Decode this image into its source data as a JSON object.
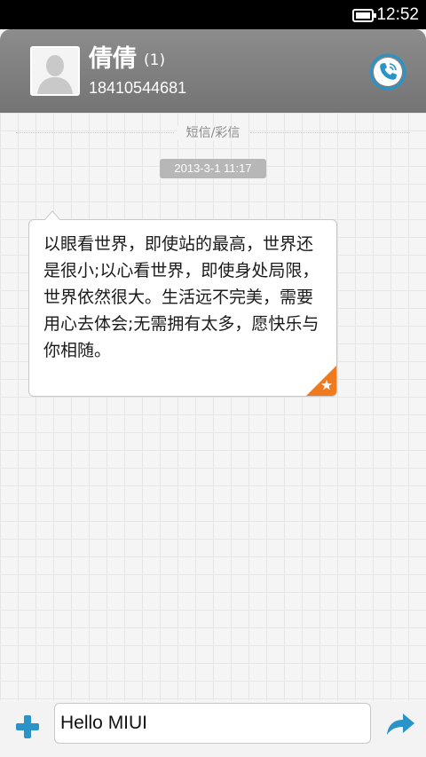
{
  "status_bar": {
    "time": "12:52",
    "icons": [
      "battery-icon"
    ]
  },
  "header": {
    "contact_name": "倩倩",
    "message_count": "(1)",
    "phone_number": "18410544681",
    "icons": [
      "avatar-placeholder-icon",
      "phone-icon"
    ],
    "colors": {
      "header_bg": "#7f7f7f",
      "call_accent": "#2a93c7"
    }
  },
  "conversation": {
    "channel_label": "短信/彩信",
    "timestamp": "2013-3-1 11:17",
    "messages": [
      {
        "text": "以眼看世界，即使站的最高，世界还是很小;以心看世界，即使身处局限，世界依然很大。生活远不完美，需要用心去体会;无需拥有太多，愿快乐与你相随。",
        "direction": "incoming",
        "starred": true,
        "icons": [
          "star-badge-icon"
        ]
      }
    ],
    "colors": {
      "star_badge": "#f07a1e"
    }
  },
  "composer": {
    "input_value": "Hello MIUI",
    "icons": [
      "add-icon",
      "send-icon"
    ],
    "colors": {
      "accent": "#2a93c7"
    }
  }
}
